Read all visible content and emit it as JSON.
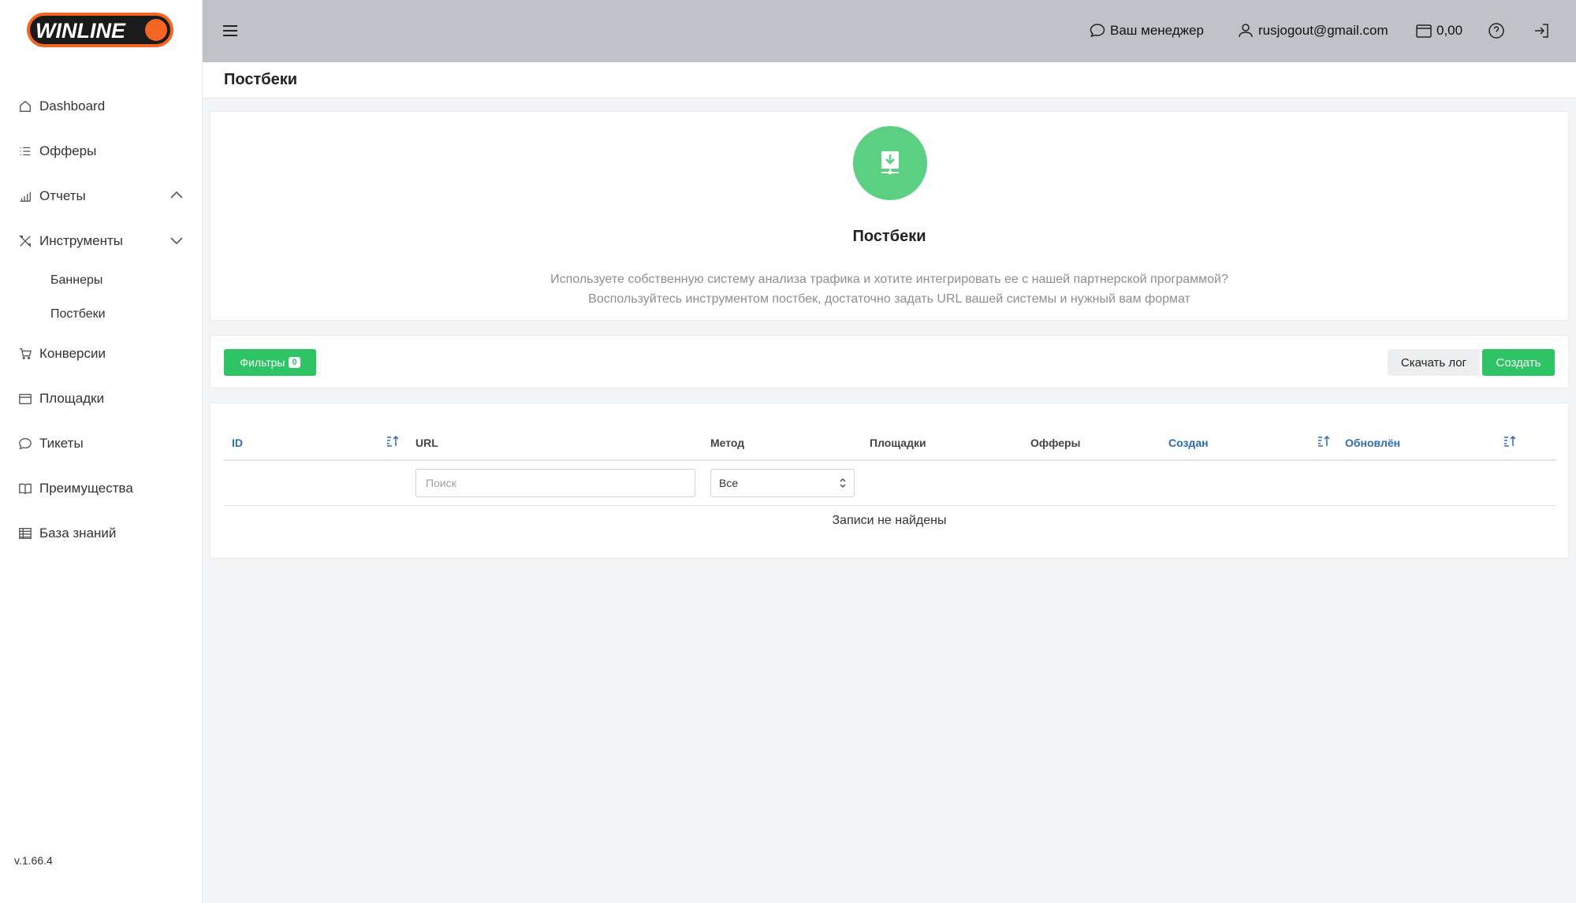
{
  "brand": {
    "logo_text": "WINLINE",
    "accent": "#f26522",
    "dark": "#1a1a1a"
  },
  "colors": {
    "green": "#2ec365",
    "link_blue": "#2d6bb5",
    "topbar": "#bfc3c7"
  },
  "sidebar": {
    "items": [
      {
        "label": "Dashboard",
        "icon": "home-icon"
      },
      {
        "label": "Офферы",
        "icon": "list-icon"
      },
      {
        "label": "Отчеты",
        "icon": "chart-icon",
        "expanded": true
      },
      {
        "label": "Инструменты",
        "icon": "tools-icon",
        "expanded": false
      },
      {
        "label": "Конверсии",
        "icon": "cart-icon"
      },
      {
        "label": "Площадки",
        "icon": "window-icon"
      },
      {
        "label": "Тикеты",
        "icon": "chat-icon"
      },
      {
        "label": "Преимущества",
        "icon": "book-icon"
      },
      {
        "label": "База знаний",
        "icon": "table-icon"
      }
    ],
    "subitems": [
      {
        "label": "Баннеры"
      },
      {
        "label": "Постбеки"
      }
    ],
    "version": "v.1.66.4"
  },
  "topbar": {
    "manager_label": "Ваш менеджер",
    "user_email": "rusjogout@gmail.com",
    "balance": "0,00"
  },
  "page": {
    "title": "Постбеки"
  },
  "hero": {
    "icon": "download-icon",
    "title": "Постбеки",
    "desc_line1": "Используете собственную систему анализа трафика и хотите интегрировать ее с нашей партнерской программой?",
    "desc_line2": "Воспользуйтесь инструментом постбек, достаточно задать URL вашей системы и нужный вам формат"
  },
  "toolbar": {
    "filters_label": "Фильтры",
    "filters_count": "0",
    "download_log_label": "Скачать лог",
    "create_label": "Создать"
  },
  "table": {
    "columns": [
      "ID",
      "URL",
      "Метод",
      "Площадки",
      "Офферы",
      "Создан",
      "Обновлён"
    ],
    "search_placeholder": "Поиск",
    "method_selected": "Все",
    "empty_message": "Записи не найдены"
  }
}
